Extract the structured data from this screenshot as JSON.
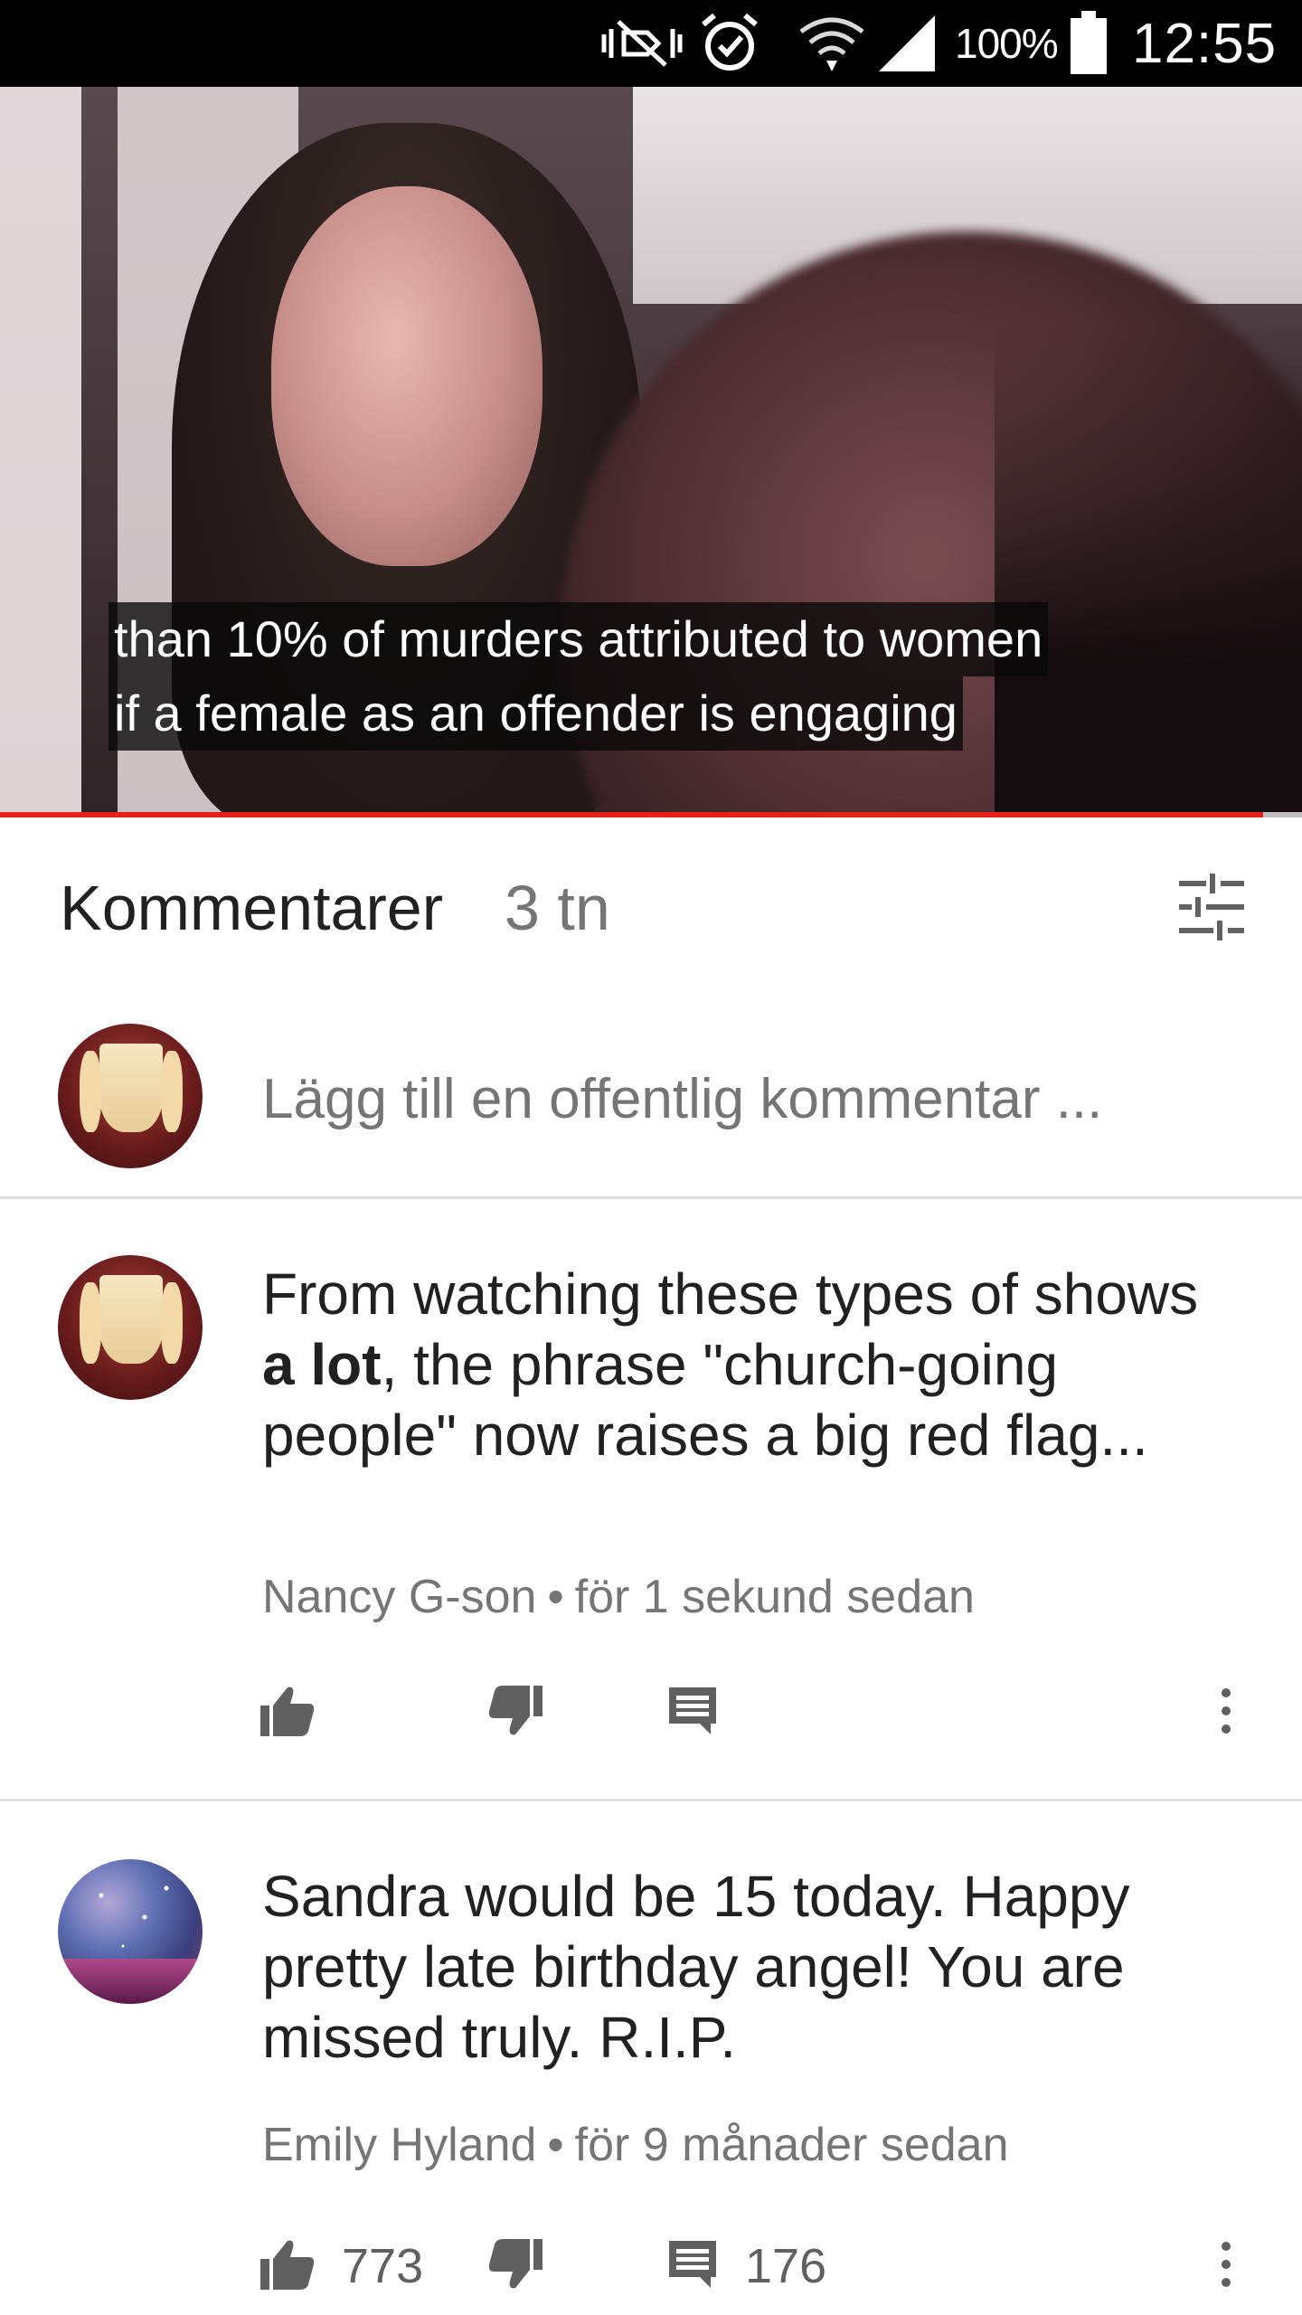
{
  "status_bar": {
    "battery_text": "100%",
    "time": "12:55",
    "icons": [
      "mute-icon",
      "alarm-icon",
      "wifi-icon",
      "signal-icon",
      "battery-icon"
    ]
  },
  "video": {
    "caption_line1": "than 10% of murders attributed to women",
    "caption_line2": "if a female as an offender is engaging",
    "progress": 0.97,
    "progress_color": "#e62117"
  },
  "comments_header": {
    "title": "Kommentarer",
    "count": "3 tn",
    "sort_icon": "sort-filter-icon"
  },
  "add_comment": {
    "placeholder": "Lägg till en offentlig kommentar ..."
  },
  "comments": [
    {
      "text_before_bold": "From watching these types of shows ",
      "text_bold": "a lot",
      "text_after_bold": ", the phrase \"church-going people\" now raises a big red flag...",
      "author": "Nancy G-son",
      "separator": "•",
      "time": "för 1 sekund sedan",
      "likes": "",
      "replies": ""
    },
    {
      "text": "Sandra would be 15 today. Happy pretty late birthday angel! You are missed truly. R.I.P.",
      "author": "Emily Hyland",
      "separator": "•",
      "time": "för 9 månader sedan",
      "likes": "773",
      "replies": "176"
    }
  ],
  "colors": {
    "accent_red": "#e62117",
    "text_primary": "#212121",
    "text_secondary": "#757575"
  }
}
